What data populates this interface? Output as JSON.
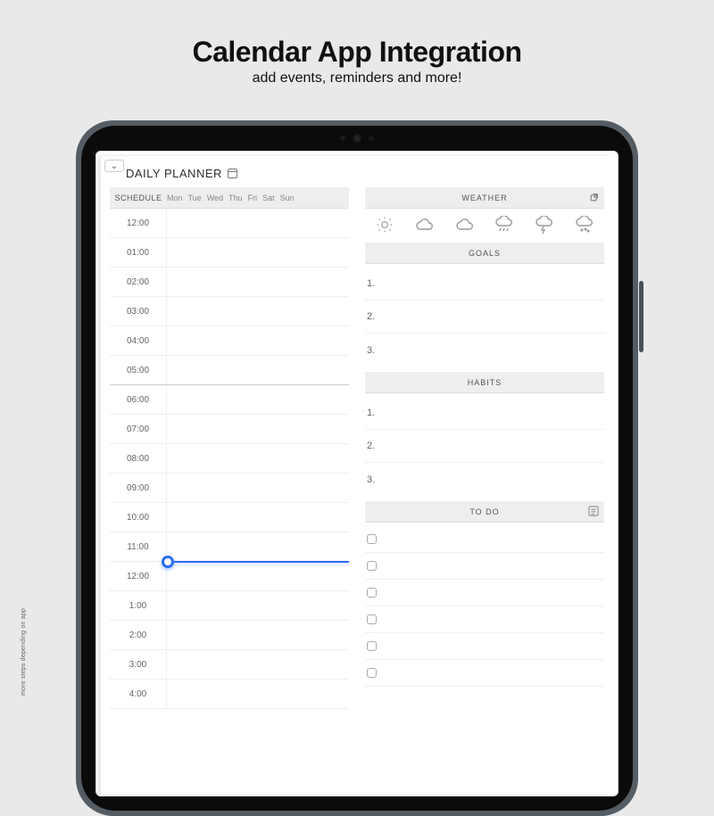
{
  "hero": {
    "title": "Calendar App Integration",
    "subtitle": "add events, reminders and more!"
  },
  "planner_title": "DAILY PLANNER",
  "schedule": {
    "label": "SCHEDULE",
    "days": [
      "Mon",
      "Tue",
      "Wed",
      "Thu",
      "Fri",
      "Sat",
      "Sun"
    ],
    "times": [
      "12:00",
      "01:00",
      "02:00",
      "03:00",
      "04:00",
      "05:00",
      "06:00",
      "07:00",
      "08:00",
      "09:00",
      "10:00",
      "11:00",
      "12:00",
      "1:00",
      "2:00",
      "3:00",
      "4:00"
    ],
    "divider_after_index": 5,
    "now_before_index": 12
  },
  "weather": {
    "label": "WEATHER"
  },
  "goals": {
    "label": "GOALS",
    "items": [
      "1.",
      "2.",
      "3."
    ]
  },
  "habits": {
    "label": "HABITS",
    "items": [
      "1.",
      "2.",
      "3."
    ]
  },
  "todo": {
    "label": "TO DO",
    "count": 6
  },
  "sidenote": "more steps depending on app"
}
